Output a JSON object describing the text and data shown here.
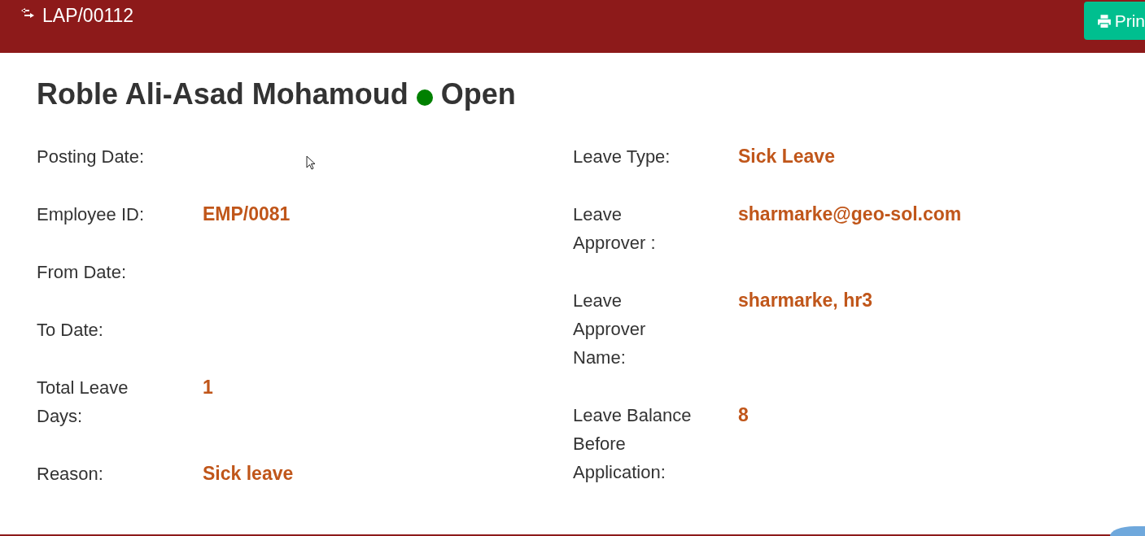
{
  "header": {
    "title": "LAP/00112",
    "print_button": "Prin"
  },
  "heading": {
    "name": "Roble Ali-Asad Mohamoud",
    "status": {
      "label": "Open",
      "color": "#008000"
    }
  },
  "left_fields": [
    {
      "label": "Posting Date:"
    },
    {
      "label": "Employee ID:",
      "value": "EMP/0081"
    },
    {
      "label": "From Date:"
    },
    {
      "label": "To Date:"
    },
    {
      "label": "Total Leave Days:",
      "value": "1"
    },
    {
      "label": "Reason:",
      "value": "Sick leave"
    }
  ],
  "right_fields": [
    {
      "label": "Leave Type:",
      "value": "Sick Leave"
    },
    {
      "label": "Leave Approver :",
      "value": "sharmarke@geo-sol.com"
    },
    {
      "label": "Leave Approver Name:",
      "value": "sharmarke, hr3"
    },
    {
      "label": "Leave Balance Before Application:",
      "value": "8"
    }
  ]
}
